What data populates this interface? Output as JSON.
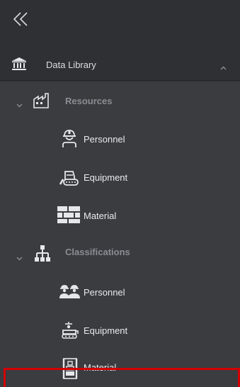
{
  "colors": {
    "background": "#2f3033",
    "section_bg": "#3a3c40",
    "text": "#e9eaec",
    "muted": "#8a8d93",
    "highlight": "#d40000"
  },
  "collapse": {
    "icon": "double-chevron-left-icon"
  },
  "data_library": {
    "label": "Data Library",
    "icon": "bank-icon",
    "expand_icon": "chevron-up-icon"
  },
  "resources": {
    "label": "Resources",
    "icon": "factory-icon",
    "expand_icon": "chevron-down-icon",
    "items": [
      {
        "label": "Personnel",
        "icon": "hardhat-worker-icon"
      },
      {
        "label": "Equipment",
        "icon": "bulldozer-icon"
      },
      {
        "label": "Material",
        "icon": "brick-wall-icon"
      }
    ]
  },
  "classifications": {
    "label": "Classifications",
    "icon": "hierarchy-icon",
    "expand_icon": "chevron-down-icon",
    "items": [
      {
        "label": "Personnel",
        "icon": "people-group-icon"
      },
      {
        "label": "Equipment",
        "icon": "machine-icon"
      },
      {
        "label": "Material",
        "icon": "material-stack-icon"
      }
    ]
  }
}
